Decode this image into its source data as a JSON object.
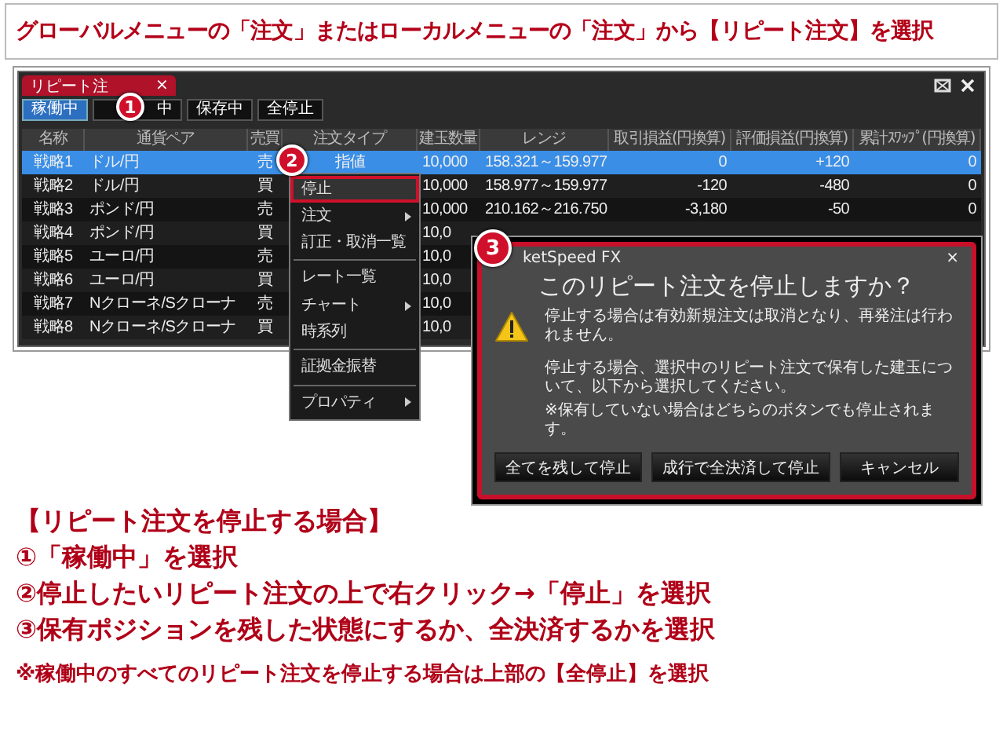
{
  "header": {
    "title": "グローバルメニューの「注文」またはローカルメニューの「注文」から【リピート注文】を選択"
  },
  "app": {
    "tab": {
      "label": "リピート注",
      "close": "×"
    },
    "filters": [
      {
        "label": "稼働中",
        "selected": true
      },
      {
        "label": "中",
        "selected": false
      },
      {
        "label": "保存中",
        "selected": false
      },
      {
        "label": "全停止",
        "selected": false
      }
    ],
    "columns": [
      "名称",
      "通貨ペア",
      "売買",
      "注文タイプ",
      "建玉数量",
      "レンジ",
      "取引損益(円換算)",
      "評価損益(円換算)",
      "累計ｽﾜｯﾌﾟ(円換算)"
    ],
    "rows": [
      {
        "selected": true,
        "cells": [
          "戦略1",
          "ドル/円",
          "売",
          "指値",
          "10,000",
          "158.321～159.977",
          "0",
          "+120",
          "0"
        ]
      },
      {
        "selected": false,
        "cells": [
          "戦略2",
          "ドル/円",
          "買",
          "",
          "10,000",
          "158.977～159.977",
          "-120",
          "-480",
          "0"
        ]
      },
      {
        "selected": false,
        "cells": [
          "戦略3",
          "ポンド/円",
          "売",
          "",
          "10,000",
          "210.162～216.750",
          "-3,180",
          "-50",
          "0"
        ]
      },
      {
        "selected": false,
        "cells": [
          "戦略4",
          "ポンド/円",
          "買",
          "",
          "10,0",
          "",
          "",
          "",
          ""
        ]
      },
      {
        "selected": false,
        "cells": [
          "戦略5",
          "ユーロ/円",
          "売",
          "",
          "10,0",
          "",
          "",
          "",
          ""
        ]
      },
      {
        "selected": false,
        "cells": [
          "戦略6",
          "ユーロ/円",
          "買",
          "",
          "10,0",
          "",
          "",
          "",
          ""
        ]
      },
      {
        "selected": false,
        "cells": [
          "戦略7",
          "Nクローネ/Sクローナ",
          "売",
          "",
          "10,0",
          "",
          "",
          "",
          ""
        ]
      },
      {
        "selected": false,
        "cells": [
          "戦略8",
          "Nクローネ/Sクローナ",
          "買",
          "",
          "10,0",
          "",
          "",
          "",
          ""
        ]
      }
    ],
    "context_menu": [
      {
        "label": "停止",
        "selected": true,
        "submenu": false,
        "separator_before": false
      },
      {
        "label": "注文",
        "selected": false,
        "submenu": true,
        "separator_before": false
      },
      {
        "label": "訂正・取消一覧",
        "selected": false,
        "submenu": false,
        "separator_before": false
      },
      {
        "label": "レート一覧",
        "selected": false,
        "submenu": false,
        "separator_before": true
      },
      {
        "label": "チャート",
        "selected": false,
        "submenu": true,
        "separator_before": false
      },
      {
        "label": "時系列",
        "selected": false,
        "submenu": false,
        "separator_before": false
      },
      {
        "label": "証拠金振替",
        "selected": false,
        "submenu": false,
        "separator_before": true
      },
      {
        "label": "プロパティ",
        "selected": false,
        "submenu": true,
        "separator_before": true
      }
    ]
  },
  "dialog": {
    "title": "ketSpeed FX",
    "close": "×",
    "question": "このリピート注文を停止しますか？",
    "paragraphs": [
      "停止する場合は有効新規注文は取消となり、再発注は行われません。",
      "停止する場合、選択中のリピート注文で保有した建玉について、以下から選択してください。",
      "※保有していない場合はどちらのボタンでも停止されます。"
    ],
    "buttons": [
      "全てを残して停止",
      "成行で全決済して停止",
      "キャンセル"
    ]
  },
  "badges": [
    "1",
    "2",
    "3"
  ],
  "instructions": {
    "heading": "【リピート注文を停止する場合】",
    "steps": [
      "①「稼働中」を選択",
      "②停止したいリピート注文の上で右クリック→「停止」を選択",
      "③保有ポジションを残した状態にするか、全決済するかを選択"
    ],
    "note": "※稼働中のすべてのリピート注文を停止する場合は上部の【全停止】を選択"
  }
}
